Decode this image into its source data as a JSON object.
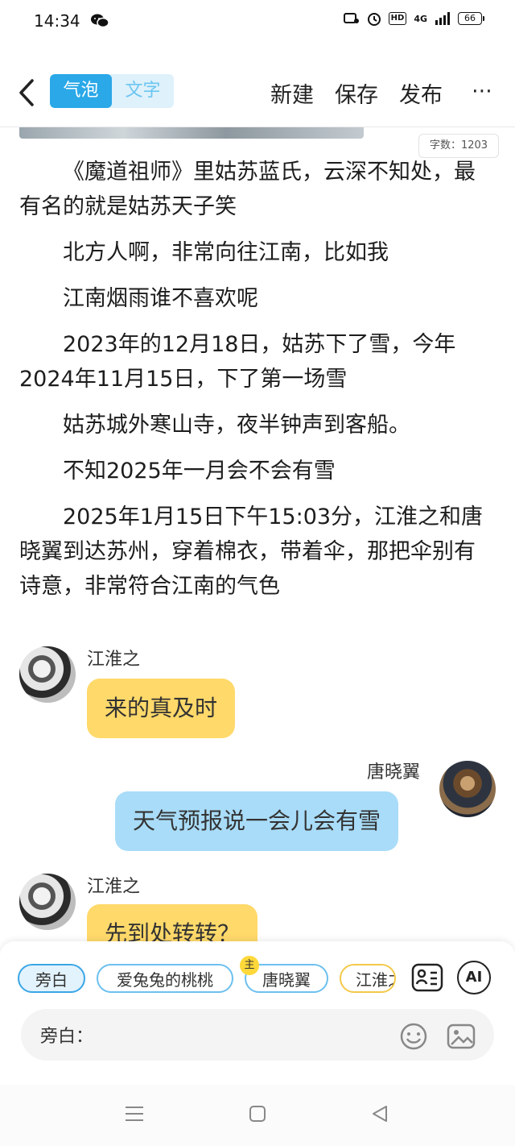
{
  "status_bar": {
    "time": "14:34",
    "hd": "HD",
    "network": "4G",
    "battery": "66"
  },
  "header": {
    "mode_active": "气泡",
    "mode_inactive": "文字",
    "actions": [
      "新建",
      "保存",
      "发布"
    ],
    "more": "⋯",
    "accent_color": "#2aa8e8"
  },
  "word_count": "字数：1203",
  "story": [
    "《魔道祖师》里姑苏蓝氏，云深不知处，最有名的就是姑苏天子笑",
    "北方人啊，非常向往江南，比如我",
    "江南烟雨谁不喜欢呢",
    "2023年的12月18日，姑苏下了雪，今年2024年11月15日，下了第一场雪",
    "姑苏城外寒山寺，夜半钟声到客船。",
    "不知2025年一月会不会有雪",
    "2025年1月15日下午15:03分，江淮之和唐晓翼到达苏州，穿着棉衣，带着伞，那把伞别有诗意，非常符合江南的气色"
  ],
  "chat": [
    {
      "speaker": "江淮之",
      "text": "来的真及时",
      "side": "left",
      "color": "#ffd96a"
    },
    {
      "speaker": "唐晓翼",
      "text": "天气预报说一会儿会有雪",
      "side": "right",
      "color": "#a9dcf8"
    },
    {
      "speaker": "江淮之",
      "text": "先到处转转？",
      "side": "left",
      "color": "#ffd96a"
    }
  ],
  "roles": {
    "chips": [
      "旁白",
      "爱兔兔的桃桃",
      "唐晓翼",
      "江淮之"
    ],
    "host_badge": "主",
    "ai_label": "AI"
  },
  "input": {
    "label": "旁白："
  }
}
